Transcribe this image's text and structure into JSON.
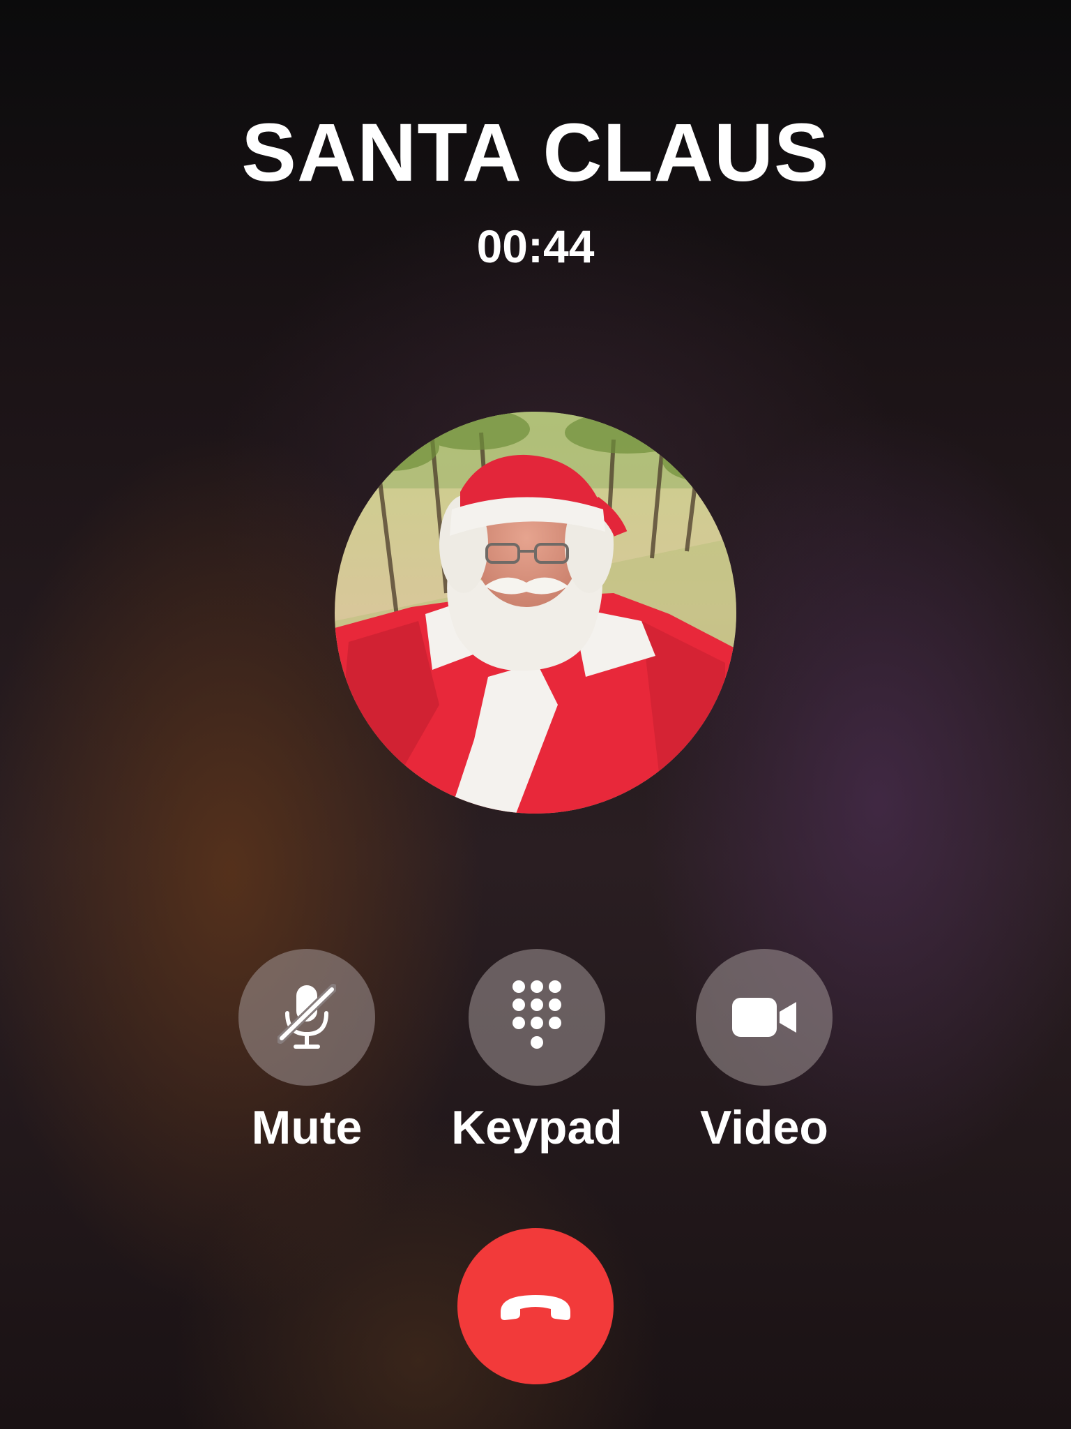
{
  "call": {
    "caller_name": "SANTA CLAUS",
    "duration": "00:44"
  },
  "avatar": {
    "icon": "contact-photo"
  },
  "controls": [
    {
      "label": "Mute",
      "icon": "microphone-slash-icon"
    },
    {
      "label": "Keypad",
      "icon": "keypad-icon"
    },
    {
      "label": "Video",
      "icon": "video-camera-icon"
    }
  ],
  "end_call": {
    "icon": "phone-down-icon",
    "color": "#f23a3a"
  }
}
